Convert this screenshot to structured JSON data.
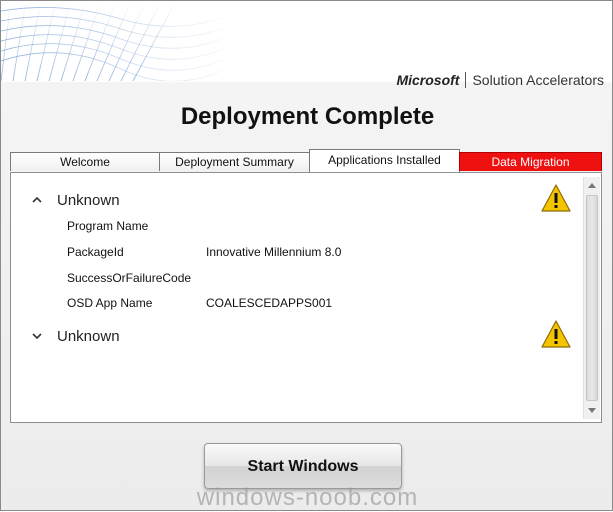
{
  "brand": {
    "company": "Microsoft",
    "product": "Solution Accelerators"
  },
  "window": {
    "title": "Deployment Complete"
  },
  "tabs": [
    {
      "label": "Welcome",
      "selected": false
    },
    {
      "label": "Deployment Summary",
      "selected": false
    },
    {
      "label": "Applications Installed",
      "selected": true
    },
    {
      "label": "Data Migration",
      "selected": false,
      "highlight_color": "#ef1010"
    }
  ],
  "groups": [
    {
      "header": "Unknown",
      "expanded": true,
      "status_icon": "warning-icon",
      "fields": [
        {
          "label": "Program Name",
          "value": ""
        },
        {
          "label": "PackageId",
          "value": "Innovative Millennium 8.0"
        },
        {
          "label": "SuccessOrFailureCode",
          "value": ""
        },
        {
          "label": "OSD App Name",
          "value": "COALESCEDAPPS001"
        }
      ]
    },
    {
      "header": "Unknown",
      "expanded": false,
      "status_icon": "warning-icon",
      "fields": []
    }
  ],
  "actions": {
    "start_label": "Start Windows"
  },
  "watermark": "windows-noob.com",
  "colors": {
    "accent_red": "#ef1010",
    "warning_yellow": "#f5c400"
  }
}
